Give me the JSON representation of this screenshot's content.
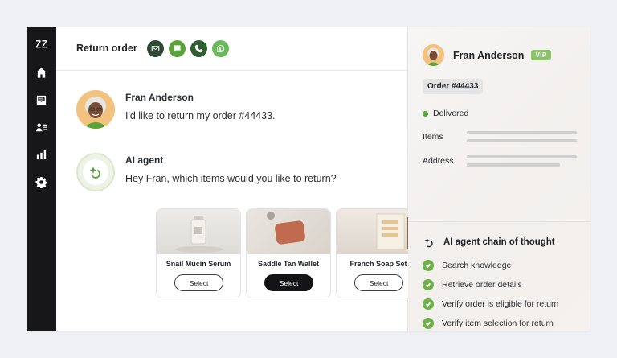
{
  "header": {
    "title": "Return order"
  },
  "channels": [
    {
      "icon": "email-icon",
      "color": "#2f4a35"
    },
    {
      "icon": "chat-icon",
      "color": "#5aa23a"
    },
    {
      "icon": "phone-icon",
      "color": "#2f5e33"
    },
    {
      "icon": "whatsapp-icon",
      "color": "#69b85a"
    }
  ],
  "rail": {
    "items": [
      "zendesk-logo-icon",
      "home-icon",
      "inbox-icon",
      "contacts-icon",
      "reports-icon",
      "settings-icon"
    ]
  },
  "conversation": {
    "customer": {
      "name": "Fran Anderson",
      "message": "I'd like to return my order #44433."
    },
    "agent": {
      "name": "AI agent",
      "message": "Hey Fran, which items would you like to return?"
    }
  },
  "products": [
    {
      "name": "Snail Mucin Serum",
      "button": "Select",
      "selected": false
    },
    {
      "name": "Saddle Tan Wallet",
      "button": "Select",
      "selected": true
    },
    {
      "name": "French Soap Set",
      "button": "Select",
      "selected": false
    }
  ],
  "sidebar": {
    "name": "Fran Anderson",
    "badge": "VIP",
    "order": "Order #44433",
    "status": "Delivered",
    "items_label": "Items",
    "address_label": "Address"
  },
  "chain": {
    "title": "AI agent chain of thought",
    "steps": [
      "Search knowledge",
      "Retrieve order details",
      "Verify order is eligible for return",
      "Verify item selection for return"
    ]
  },
  "colors": {
    "accent": "#5aa23a",
    "rail": "#17171a"
  }
}
